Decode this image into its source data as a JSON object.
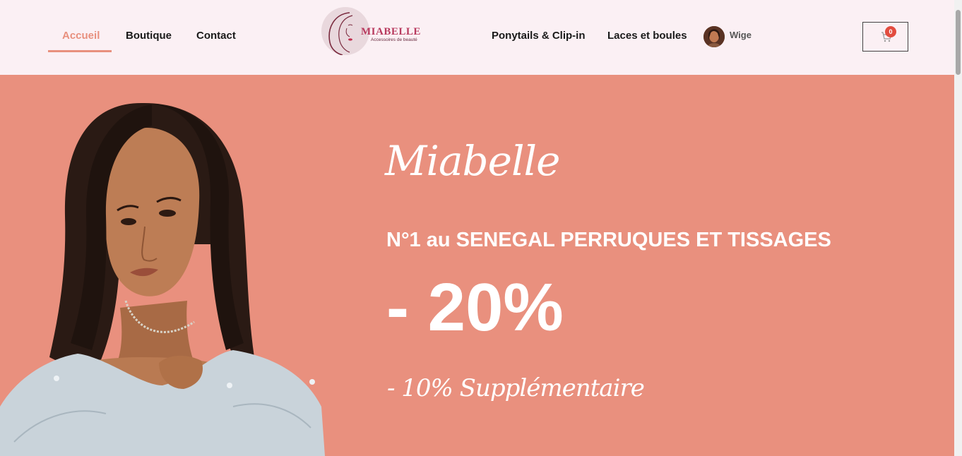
{
  "nav": {
    "left": [
      {
        "label": "Accueil",
        "active": true
      },
      {
        "label": "Boutique"
      },
      {
        "label": "Contact"
      }
    ],
    "right": [
      {
        "label": "Ponytails & Clip-in"
      },
      {
        "label": "Laces et boules"
      }
    ]
  },
  "logo": {
    "text": "MIABELLE",
    "subtitle": "Accessoires de beauté"
  },
  "user": {
    "name": "Wige"
  },
  "cart": {
    "count": "0",
    "icon": "cart-icon"
  },
  "hero": {
    "script_title": "Miabelle",
    "headline": "N°1 au SENEGAL PERRUQUES ET TISSAGES",
    "discount": "- 20%",
    "extra": "- 10% Supplémentaire"
  },
  "colors": {
    "accent": "#e8907e",
    "hero_bg": "#e9907e",
    "header_bg": "#fbf0f4",
    "badge": "#e24c3f",
    "logo": "#b83a5e"
  }
}
